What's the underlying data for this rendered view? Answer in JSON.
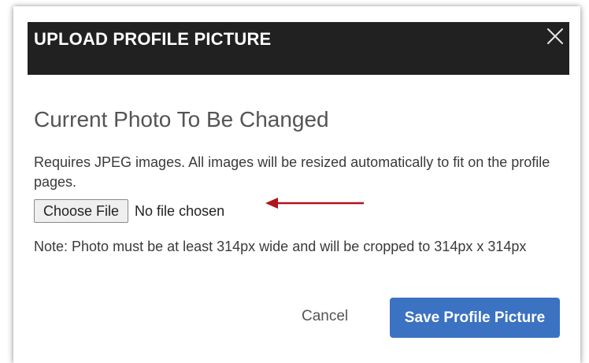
{
  "header": {
    "title": "UPLOAD PROFILE PICTURE",
    "close_icon": "close-icon"
  },
  "content": {
    "section_title": "Current Photo To Be Changed",
    "description": "Requires JPEG images. All images will be resized automatically to fit on the profile pages.",
    "file_input": {
      "button_label": "Choose File",
      "status_text": "No file chosen"
    },
    "note": "Note: Photo must be at least 314px wide and will be cropped to 314px x 314px"
  },
  "footer": {
    "cancel_label": "Cancel",
    "save_label": "Save Profile Picture"
  },
  "colors": {
    "header_bg": "#212121",
    "primary_button": "#3b72c2",
    "annotation_arrow": "#b0141c"
  }
}
